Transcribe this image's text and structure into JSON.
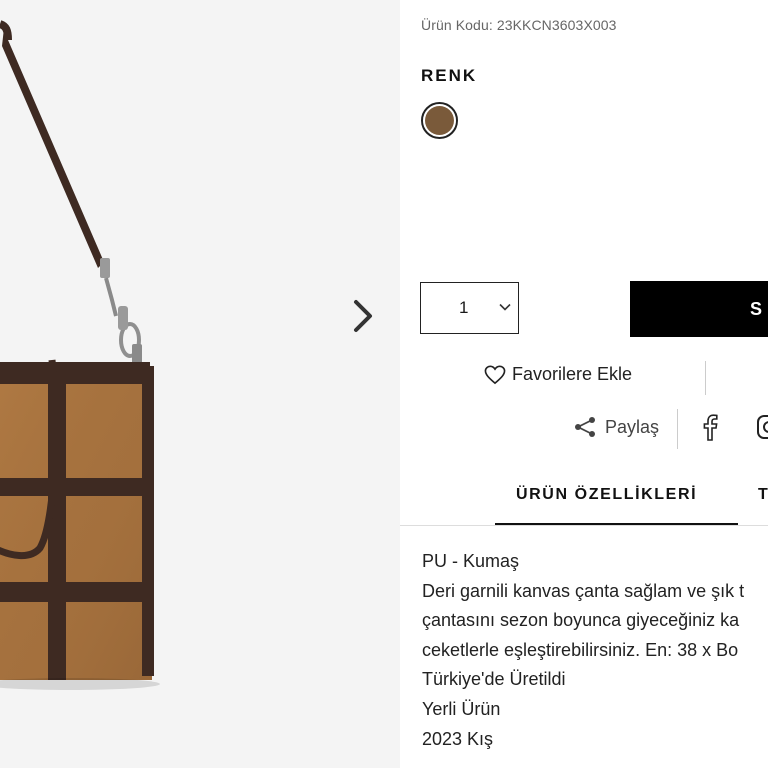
{
  "product": {
    "code_label": "Ürün Kodu:",
    "code_value": "23KKCN3603X003",
    "color_heading": "RENK",
    "swatch_color": "#7a5a3a"
  },
  "purchase": {
    "quantity": "1",
    "add_button_label": "S"
  },
  "actions": {
    "favorite_label": "Favorilere Ekle",
    "share_label": "Paylaş"
  },
  "tabs": [
    {
      "label": "ÜRÜN ÖZELLİKLERİ"
    },
    {
      "label": "T"
    }
  ],
  "description": [
    "PU - Kumaş",
    "Deri garnili kanvas çanta sağlam ve şık t",
    "çantasını sezon boyunca giyeceğiniz ka",
    "ceketlerle eşleştirebilirsiniz. En: 38 x Bo",
    "Türkiye'de Üretildi",
    "Yerli Ürün",
    "2023 Kış"
  ],
  "colors": {
    "bag_suede": "#a8733f",
    "bag_strap": "#3e2a22",
    "gallery_bg": "#f4f4f4",
    "button_bg": "#000000"
  },
  "icons": {
    "next": "chevron-right-icon",
    "favorite": "heart-icon",
    "share": "share-icon",
    "facebook": "facebook-icon",
    "instagram": "instagram-icon",
    "select": "chevron-down-icon"
  }
}
